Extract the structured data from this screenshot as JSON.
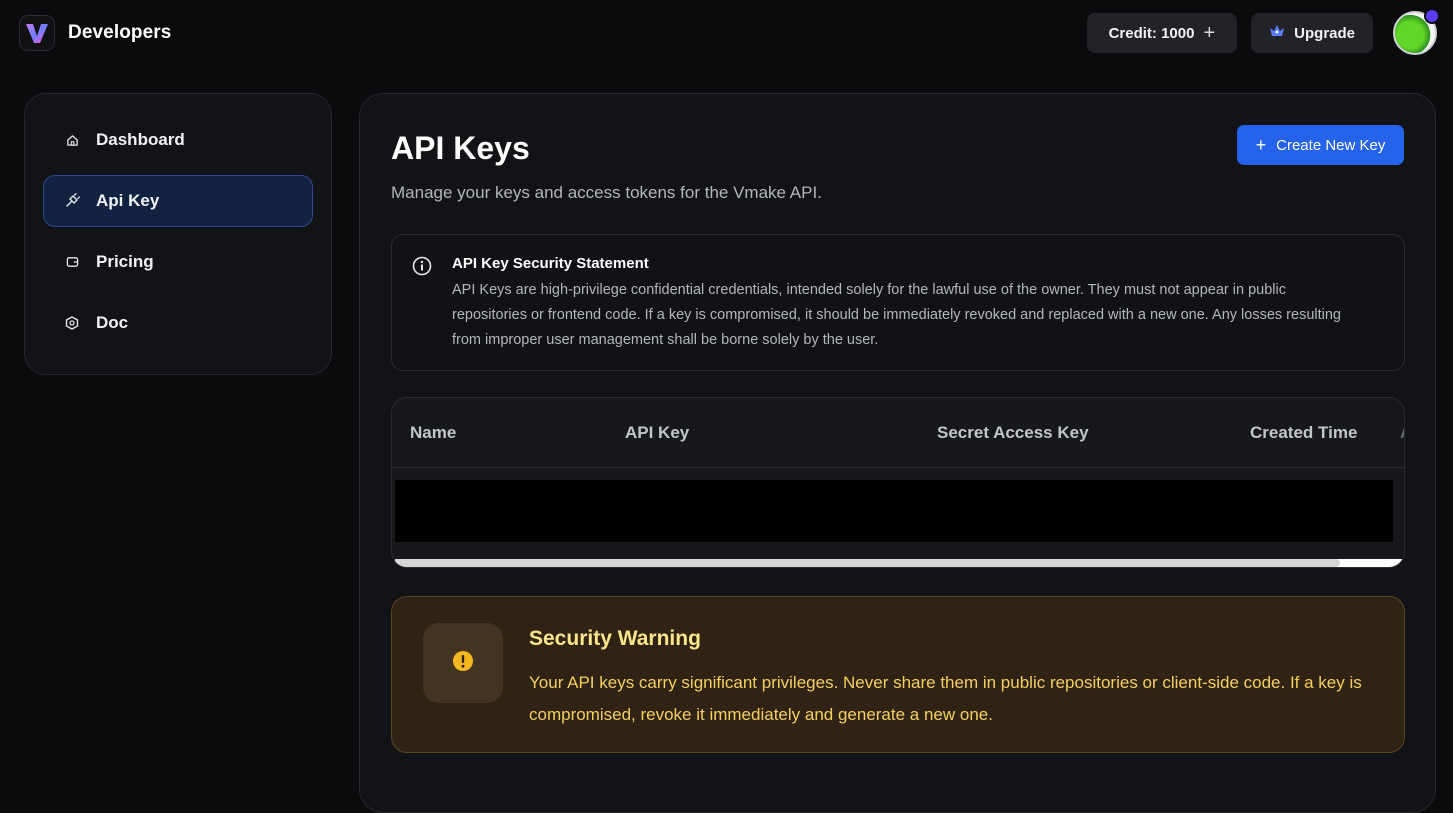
{
  "header": {
    "brand_title": "Developers",
    "logo_icon": "vmake-logo-icon",
    "credit_label": "Credit: 1000",
    "credit_plus": "+",
    "upgrade_label": "Upgrade"
  },
  "sidebar": {
    "items": [
      {
        "label": "Dashboard",
        "icon": "home-icon",
        "active": false
      },
      {
        "label": "Api Key",
        "icon": "plug-icon",
        "active": true
      },
      {
        "label": "Pricing",
        "icon": "wallet-icon",
        "active": false
      },
      {
        "label": "Doc",
        "icon": "hexagon-icon",
        "active": false
      }
    ]
  },
  "main": {
    "title": "API Keys",
    "subtitle": "Manage your keys and access tokens for the Vmake API.",
    "create_button": "Create New Key",
    "create_plus": "+",
    "statement": {
      "title": "API Key Security Statement",
      "body": "API Keys are high-privilege confidential credentials, intended solely for the lawful use of the owner. They must not appear in public repositories or frontend code. If a key is compromised, it should be immediately revoked and replaced with a new one. Any losses resulting from improper user management shall be borne solely by the user."
    },
    "table": {
      "columns": [
        "Name",
        "API Key",
        "Secret Access Key",
        "Created Time",
        "A"
      ]
    },
    "warning": {
      "title": "Security Warning",
      "body": "Your API keys carry significant privileges. Never share them in public repositories or client-side code. If a key is compromised, revoke it immediately and generate a new one."
    }
  },
  "colors": {
    "accent": "#2563eb",
    "active_nav_bg": "#142241",
    "warning_bg": "#2e2314",
    "warning_text": "#f7cf5e"
  }
}
